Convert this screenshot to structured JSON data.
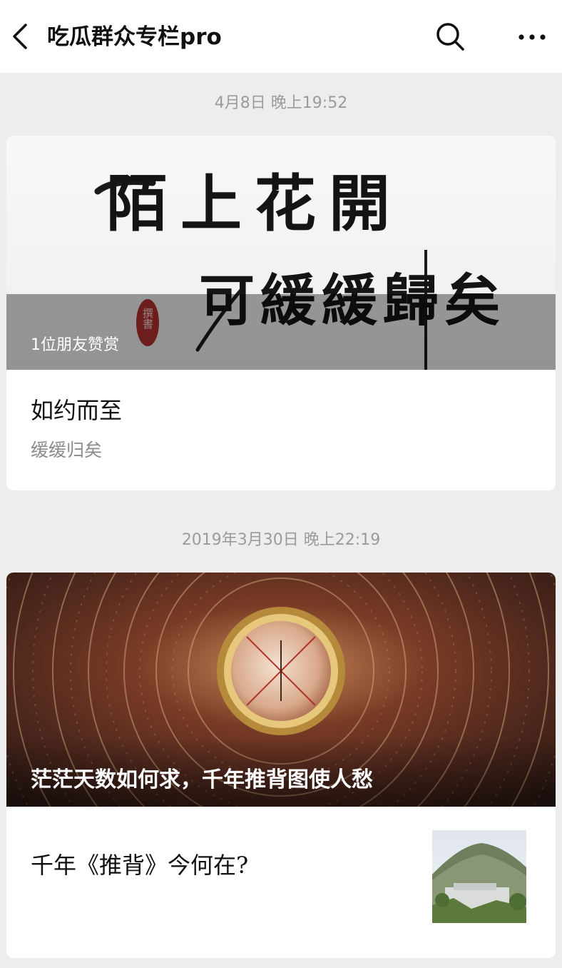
{
  "header": {
    "title": "吃瓜群众专栏pro",
    "back_icon": "chevron-left-icon",
    "search_icon": "search-icon",
    "more_icon": "more-horizontal-icon"
  },
  "posts": [
    {
      "timestamp": "4月8日 晚上19:52",
      "cover_calligraphy_line1": "陌上花開",
      "cover_calligraphy_line2": "可緩緩歸矣",
      "cover_seal": "撰書",
      "cover_overlay": "1位朋友赞赏",
      "title": "如约而至",
      "subtitle": "缓缓归矣"
    },
    {
      "timestamp": "2019年3月30日 晚上22:19",
      "cover_caption": "茫茫天数如何求，千年推背图使人愁",
      "title": "千年《推背》今何在?"
    }
  ],
  "colors": {
    "background": "#ededed",
    "card": "#ffffff",
    "timestamp_text": "#9b9b9b",
    "title_text": "#111111"
  }
}
